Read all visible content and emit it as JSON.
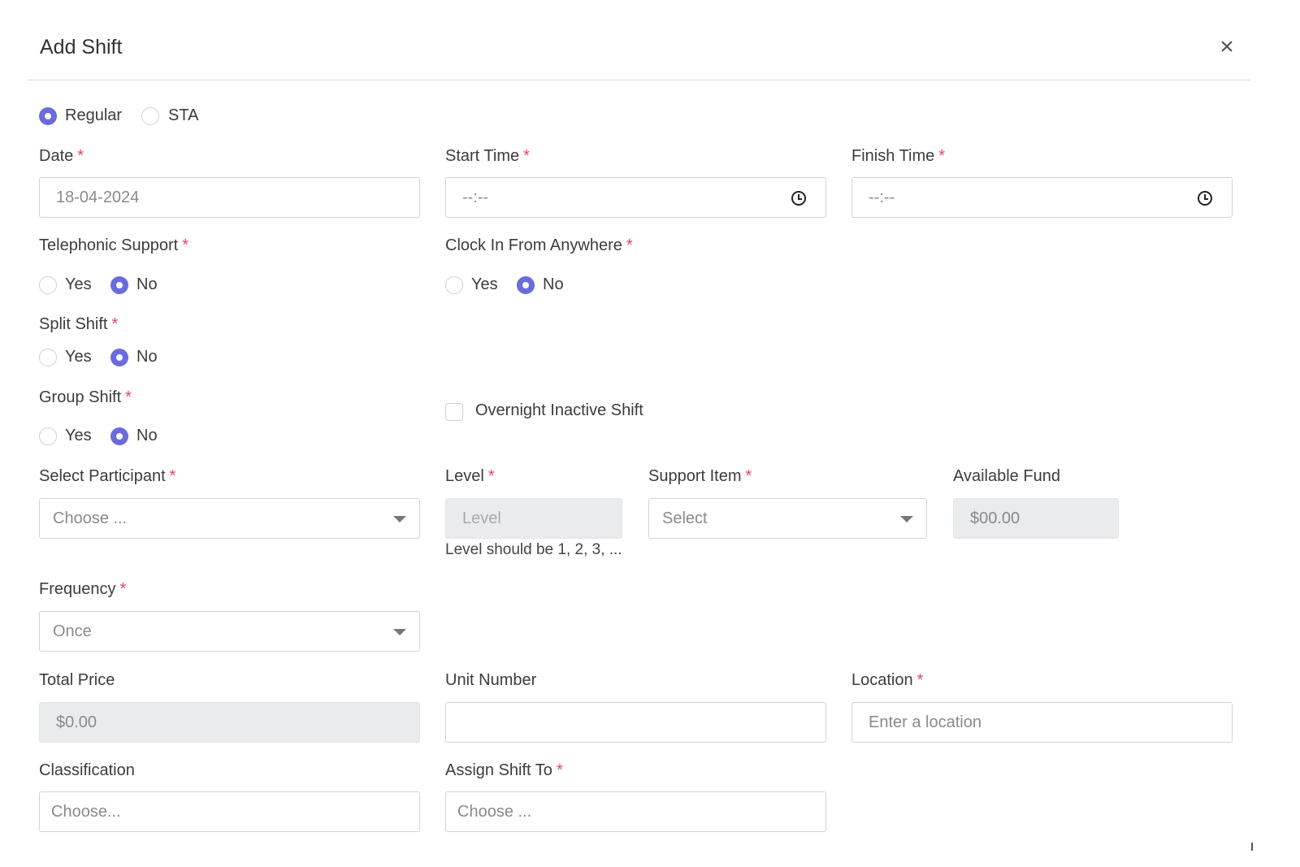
{
  "modal": {
    "title": "Add Shift",
    "close_label": "×"
  },
  "shift_type": {
    "options": [
      "Regular",
      "STA"
    ],
    "selected": "Regular"
  },
  "date": {
    "label": "Date",
    "value": "18-04-2024"
  },
  "start_time": {
    "label": "Start Time",
    "value": "--:--"
  },
  "finish_time": {
    "label": "Finish Time",
    "value": "--:--"
  },
  "telephonic_support": {
    "label": "Telephonic Support",
    "yes": "Yes",
    "no": "No",
    "selected": "No"
  },
  "clock_in_anywhere": {
    "label": "Clock In From Anywhere",
    "yes": "Yes",
    "no": "No",
    "selected": "No"
  },
  "split_shift": {
    "label": "Split Shift",
    "yes": "Yes",
    "no": "No",
    "selected": "No"
  },
  "group_shift": {
    "label": "Group Shift",
    "yes": "Yes",
    "no": "No",
    "selected": "No"
  },
  "overnight": {
    "label": "Overnight Inactive Shift",
    "checked": false
  },
  "participant": {
    "label": "Select Participant",
    "placeholder": "Choose ..."
  },
  "level": {
    "label": "Level",
    "placeholder": "Level",
    "hint": "Level should be 1, 2, 3, ..."
  },
  "support_item": {
    "label": "Support Item",
    "placeholder": "Select"
  },
  "available_fund": {
    "label": "Available Fund",
    "value": "$00.00"
  },
  "frequency": {
    "label": "Frequency",
    "value": "Once"
  },
  "total_price": {
    "label": "Total Price",
    "value": "$0.00"
  },
  "unit_number": {
    "label": "Unit Number",
    "value": ""
  },
  "location": {
    "label": "Location",
    "placeholder": "Enter a location"
  },
  "classification": {
    "label": "Classification",
    "placeholder": "Choose..."
  },
  "assign_to": {
    "label": "Assign Shift To",
    "placeholder": "Choose ..."
  },
  "required_mark": "*",
  "colors": {
    "accent": "#6b6bde",
    "required": "#e8445a",
    "disabled_bg": "#e9ebed"
  }
}
